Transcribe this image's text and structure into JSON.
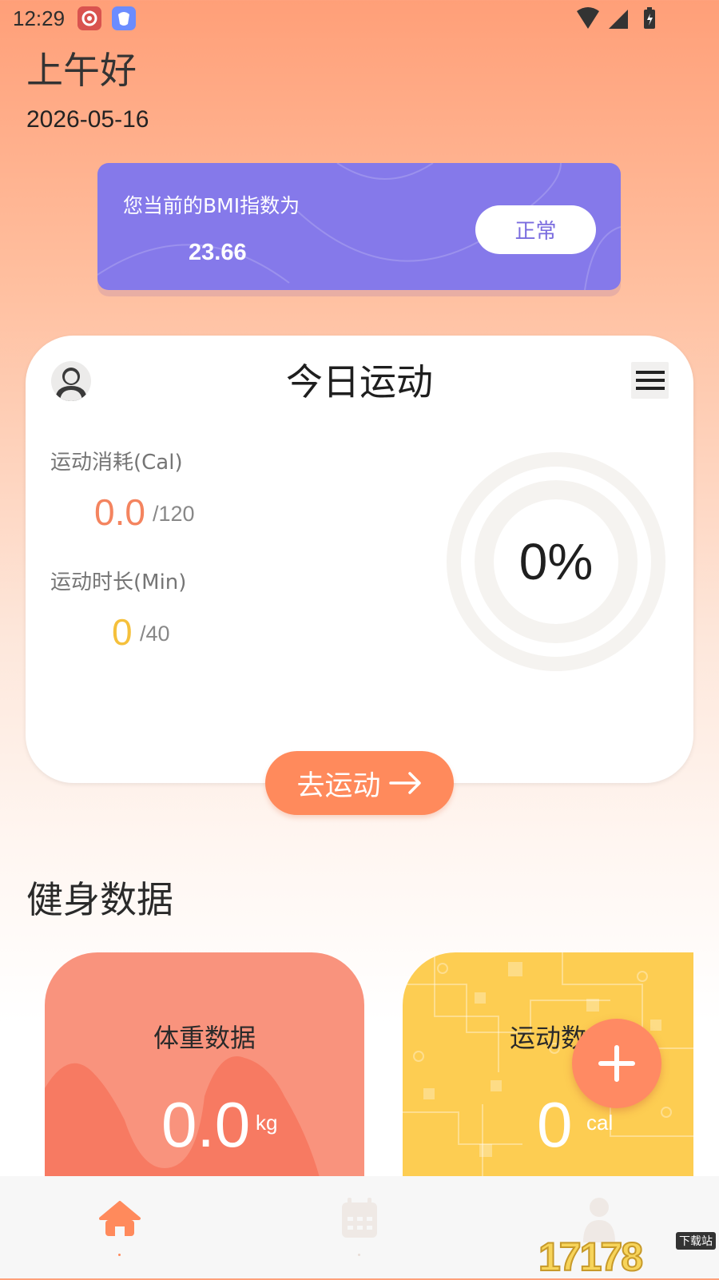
{
  "status_bar": {
    "time": "12:29"
  },
  "header": {
    "greeting": "上午好",
    "date": "2026-05-16"
  },
  "bmi": {
    "title": "您当前的BMI指数为",
    "value": "23.66",
    "status": "正常"
  },
  "today": {
    "title": "今日运动",
    "calories": {
      "label": "运动消耗(Cal)",
      "value": "0.0",
      "target": "/120"
    },
    "duration": {
      "label": "运动时长(Min)",
      "value": "0",
      "target": "/40"
    },
    "progress_percent": "0%",
    "progress_fraction": 0,
    "go_label": "去运动"
  },
  "fitness": {
    "section_title": "健身数据",
    "weight": {
      "title": "体重数据",
      "value": "0.0",
      "unit": "kg"
    },
    "sport": {
      "title": "运动数",
      "value": "0",
      "unit": "cal"
    }
  },
  "colors": {
    "accent_orange": "#ff8a5c",
    "bmi_purple": "#8579ea",
    "calorie_orange": "#f4845f",
    "duration_yellow": "#f5c03b",
    "weight_card": "#f9937d",
    "sport_card": "#fdcd52"
  },
  "nav": {
    "items": [
      "home-icon",
      "calendar-icon",
      "person-icon"
    ],
    "active": "home-icon"
  },
  "watermark": {
    "text": "17178",
    "tag": "下载站"
  }
}
